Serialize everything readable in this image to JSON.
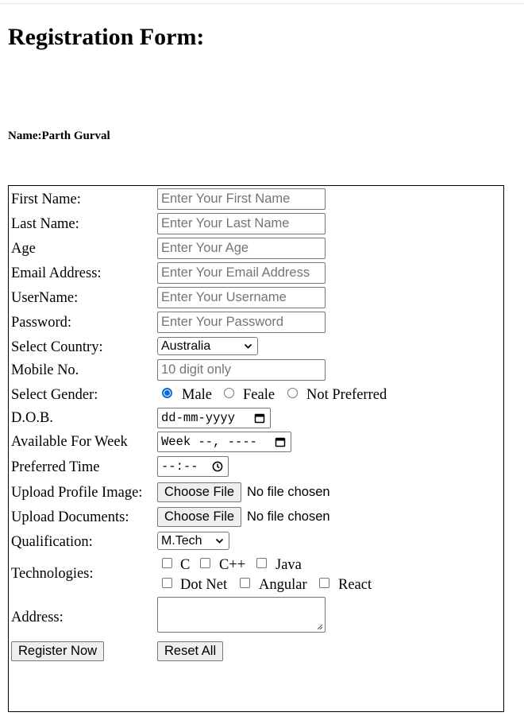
{
  "page": {
    "title": "Registration Form:",
    "author": "Name:Parth Gurval"
  },
  "form": {
    "first_name": {
      "label": "First Name:",
      "placeholder": "Enter Your First Name"
    },
    "last_name": {
      "label": "Last Name:",
      "placeholder": "Enter Your Last Name"
    },
    "age": {
      "label": "Age",
      "placeholder": "Enter Your Age"
    },
    "email": {
      "label": "Email Address:",
      "placeholder": "Enter Your Email Address"
    },
    "username": {
      "label": "UserName:",
      "placeholder": "Enter Your Username"
    },
    "password": {
      "label": "Password:",
      "placeholder": "Enter Your Password"
    },
    "country": {
      "label": "Select Country:",
      "selected": "Australia",
      "icon": "chevron-down-icon"
    },
    "mobile": {
      "label": "Mobile No.",
      "placeholder": "10 digit only"
    },
    "gender": {
      "label": "Select Gender:",
      "options": [
        "Male",
        "Feale",
        "Not Preferred"
      ],
      "selected": "Male",
      "accent_color": "#0b6cd6"
    },
    "dob": {
      "label": "D.O.B.",
      "value": "dd-mm-yyyy",
      "icon": "calendar-icon"
    },
    "week": {
      "label": "Available For Week",
      "value": "Week --, ----",
      "icon": "calendar-icon"
    },
    "time": {
      "label": "Preferred Time",
      "value": "--:--",
      "icon": "clock-icon"
    },
    "profile_image": {
      "label": "Upload Profile Image:",
      "button": "Choose File",
      "status": "No file chosen"
    },
    "documents": {
      "label": "Upload Documents:",
      "button": "Choose File",
      "status": "No file chosen"
    },
    "qualification": {
      "label": "Qualification:",
      "selected": "M.Tech",
      "icon": "chevron-down-icon"
    },
    "technologies": {
      "label": "Technologies:",
      "options": [
        "C",
        "C++",
        "Java",
        "Dot Net",
        "Angular",
        "React"
      ]
    },
    "address": {
      "label": "Address:",
      "icon": "resize-grip-icon"
    },
    "register_button": "Register Now",
    "reset_button": "Reset All"
  }
}
